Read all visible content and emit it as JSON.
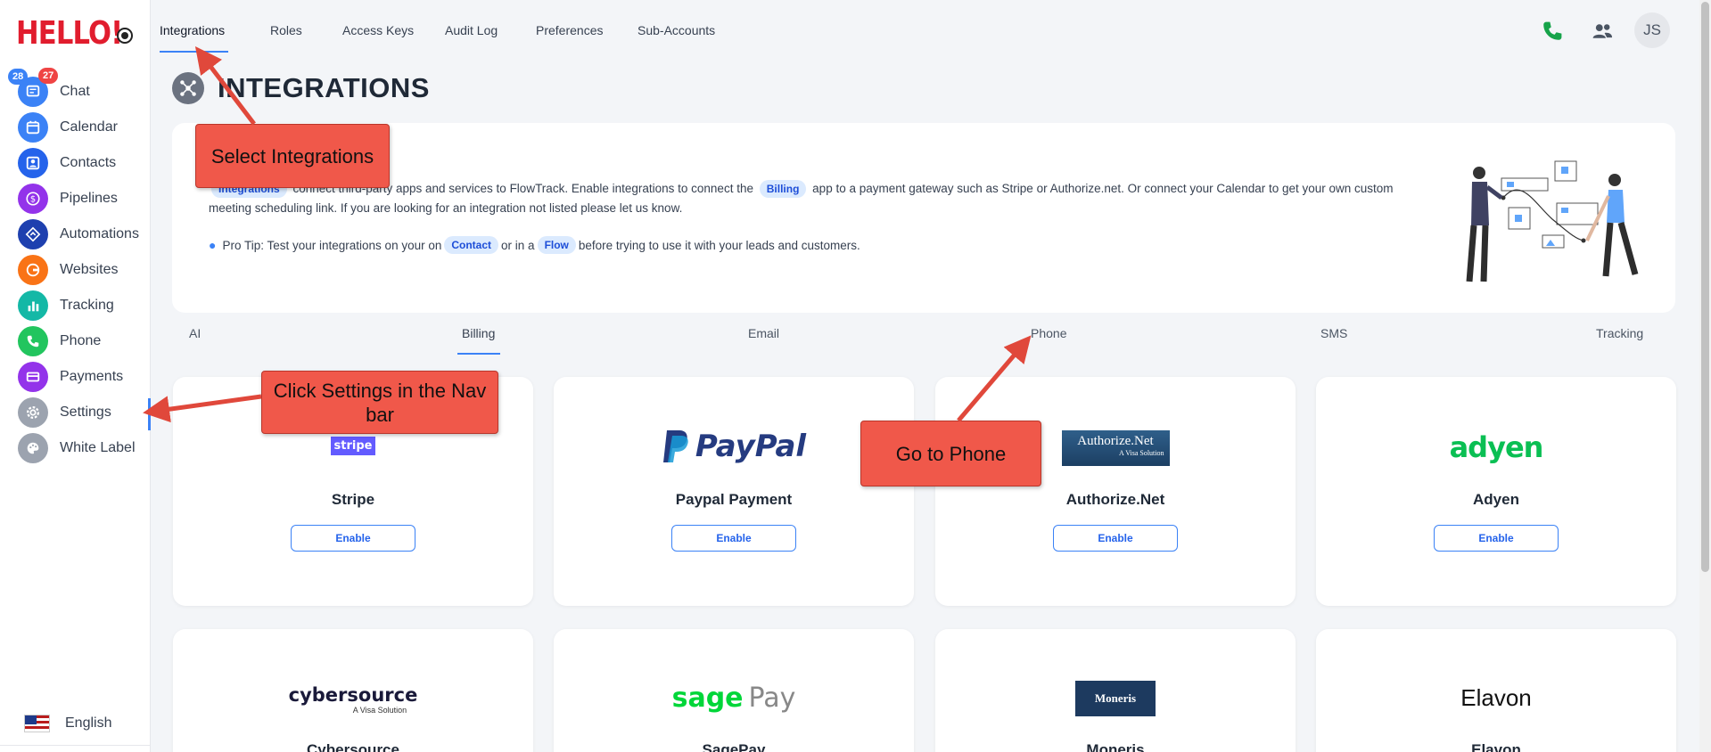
{
  "app": {
    "logo_text": "HELLO!",
    "badges": {
      "chat_blue": "28",
      "chat_red": "27"
    }
  },
  "sidebar": {
    "items": [
      {
        "label": "Chat",
        "icon": "chat-icon",
        "color": "#3b82f6"
      },
      {
        "label": "Calendar",
        "icon": "calendar-icon",
        "color": "#3b82f6"
      },
      {
        "label": "Contacts",
        "icon": "contacts-icon",
        "color": "#2563eb"
      },
      {
        "label": "Pipelines",
        "icon": "dollar-icon",
        "color": "#9333ea"
      },
      {
        "label": "Automations",
        "icon": "automation-icon",
        "color": "#1e40af"
      },
      {
        "label": "Websites",
        "icon": "websites-icon",
        "color": "#f97316"
      },
      {
        "label": "Tracking",
        "icon": "chart-icon",
        "color": "#14b8a6"
      },
      {
        "label": "Phone",
        "icon": "phone-icon",
        "color": "#22c55e"
      },
      {
        "label": "Payments",
        "icon": "card-icon",
        "color": "#9333ea"
      },
      {
        "label": "Settings",
        "icon": "gear-icon",
        "color": "#9ca3af"
      },
      {
        "label": "White Label",
        "icon": "palette-icon",
        "color": "#9ca3af"
      }
    ],
    "language": "English"
  },
  "topnav": {
    "tabs": [
      "Integrations",
      "Roles",
      "Access Keys",
      "Audit Log",
      "Preferences",
      "Sub-Accounts"
    ],
    "active_tab": "Integrations",
    "avatar_initials": "JS"
  },
  "page": {
    "title": "INTEGRATIONS",
    "info": {
      "chip_integrations": "Integrations",
      "text_1": "connect third-party apps and services to FlowTrack. Enable integrations to connect the",
      "chip_billing": "Billing",
      "text_2": "app to a payment gateway such as Stripe or Authorize.net. Or connect your Calendar to get your own custom meeting scheduling link. If you are looking for an integration not listed please let us know.",
      "tip_1": "Pro Tip: Test your integrations on your on",
      "chip_contact": "Contact",
      "tip_2": "or in a",
      "chip_flow": "Flow",
      "tip_3": "before trying to use it with your leads and customers."
    },
    "categories": [
      "AI",
      "Billing",
      "Email",
      "Phone",
      "SMS",
      "Tracking"
    ],
    "active_category": "Billing"
  },
  "integrations": [
    {
      "name": "Stripe",
      "logo": "stripe",
      "button": "Enable"
    },
    {
      "name": "Paypal Payment",
      "logo": "PayPal",
      "button": "Enable"
    },
    {
      "name": "Authorize.Net",
      "logo": "Authorize.Net",
      "logo_sub": "A Visa Solution",
      "button": "Enable"
    },
    {
      "name": "Adyen",
      "logo": "adyen",
      "button": "Enable"
    },
    {
      "name": "Cybersource",
      "logo": "cybersource",
      "logo_sub": "A Visa Solution"
    },
    {
      "name": "SagePay",
      "logo": "sage",
      "logo_b": "Pay"
    },
    {
      "name": "Moneris",
      "logo": "Moneris"
    },
    {
      "name": "Elavon",
      "logo": "Elavon"
    }
  ],
  "annotations": {
    "select_integrations": "Select Integrations",
    "click_settings": "Click Settings in the Nav bar",
    "go_to_phone": "Go to Phone"
  },
  "colors": {
    "accent": "#3b82f6",
    "callout": "#f0584a",
    "phone_green": "#16a34a"
  }
}
